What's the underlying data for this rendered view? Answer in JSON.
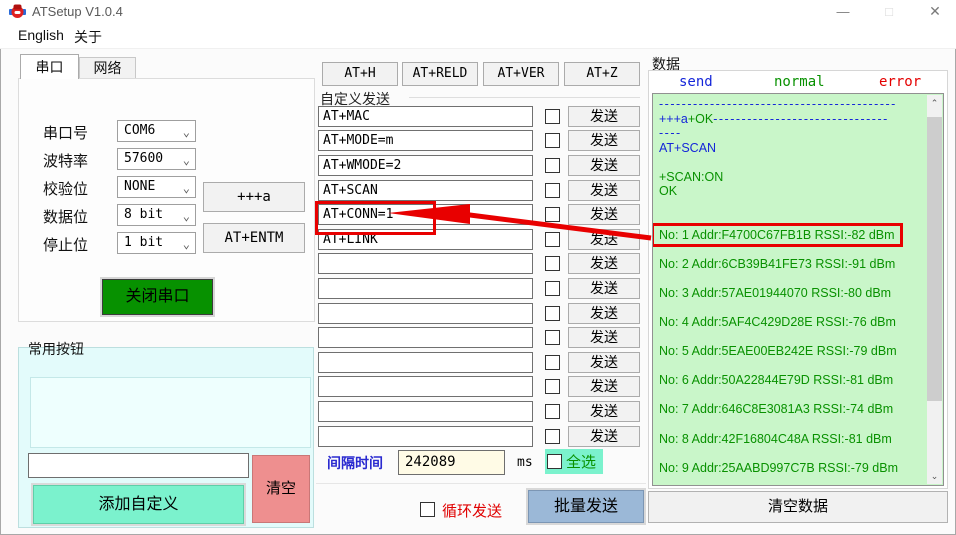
{
  "window": {
    "title": "ATSetup V1.0.4",
    "minimize_glyph": "—",
    "maximize_glyph": "□",
    "close_glyph": "✕"
  },
  "menu": {
    "items": [
      "English",
      "关于"
    ]
  },
  "serial": {
    "tabs": [
      {
        "label": "串口",
        "active": true
      },
      {
        "label": "网络",
        "active": false
      }
    ],
    "fields": [
      {
        "label": "串口号",
        "value": "COM6"
      },
      {
        "label": "波特率",
        "value": "57600"
      },
      {
        "label": "校验位",
        "value": "NONE"
      },
      {
        "label": "数据位",
        "value": "8 bit"
      },
      {
        "label": "停止位",
        "value": "1 bit"
      }
    ],
    "chevron_glyph": "⌄",
    "plus_a_button": "+++a",
    "entm_button": "AT+ENTM",
    "close_port_button": "关闭串口"
  },
  "common": {
    "title": "常用按钮",
    "input_value": "",
    "add_button": "添加自定义",
    "clear_button": "清空"
  },
  "quick_buttons": [
    "AT+H",
    "AT+RELD",
    "AT+VER",
    "AT+Z"
  ],
  "custom_send": {
    "title": "自定义发送",
    "send_label": "发送",
    "rows": [
      {
        "value": "AT+MAC",
        "checked": false,
        "highlight": false
      },
      {
        "value": "AT+MODE=m",
        "checked": false,
        "highlight": false
      },
      {
        "value": "AT+WMODE=2",
        "checked": false,
        "highlight": false
      },
      {
        "value": "AT+SCAN",
        "checked": false,
        "highlight": false
      },
      {
        "value": "AT+CONN=1",
        "checked": false,
        "highlight": true
      },
      {
        "value": "AT+LINK",
        "checked": false,
        "highlight": false
      },
      {
        "value": "",
        "checked": false,
        "highlight": false
      },
      {
        "value": "",
        "checked": false,
        "highlight": false
      },
      {
        "value": "",
        "checked": false,
        "highlight": false
      },
      {
        "value": "",
        "checked": false,
        "highlight": false
      },
      {
        "value": "",
        "checked": false,
        "highlight": false
      },
      {
        "value": "",
        "checked": false,
        "highlight": false
      },
      {
        "value": "",
        "checked": false,
        "highlight": false
      },
      {
        "value": "",
        "checked": false,
        "highlight": false
      }
    ],
    "interval_label": "间隔时间",
    "interval_value": "242089",
    "interval_unit": "ms",
    "select_all_label": "全选",
    "loop_send_label": "循环发送",
    "batch_send_label": "批量发送"
  },
  "data_panel": {
    "title": "数据",
    "colors": {
      "send": "#1526d9",
      "normal": "#089100",
      "error": "#e40000"
    },
    "legend": [
      {
        "label": "send",
        "type": "send"
      },
      {
        "label": "normal",
        "type": "normal"
      },
      {
        "label": "error",
        "type": "error"
      }
    ],
    "log": [
      {
        "segments": [
          {
            "t": "------------------------------------------",
            "c": "send",
            "dash": true
          }
        ]
      },
      {
        "segments": [
          {
            "t": "+++a",
            "c": "send"
          },
          {
            "t": "+OK",
            "c": "normal"
          },
          {
            "t": "-------------------------------",
            "c": "send",
            "dash": true
          }
        ]
      },
      {
        "segments": [
          {
            "t": "----",
            "c": "send",
            "dash": true
          }
        ]
      },
      {
        "segments": [
          {
            "t": "AT+SCAN",
            "c": "send"
          }
        ]
      },
      {
        "segments": []
      },
      {
        "segments": [
          {
            "t": "+SCAN:ON",
            "c": "normal"
          }
        ]
      },
      {
        "segments": [
          {
            "t": "OK",
            "c": "normal"
          }
        ]
      },
      {
        "segments": []
      },
      {
        "segments": []
      },
      {
        "segments": [
          {
            "t": "No: 1 Addr:F4700C67FB1B RSSI:-82 dBm",
            "c": "normal"
          }
        ],
        "boxed": true
      },
      {
        "segments": []
      },
      {
        "segments": [
          {
            "t": "No: 2 Addr:6CB39B41FE73 RSSI:-91 dBm",
            "c": "normal"
          }
        ]
      },
      {
        "segments": []
      },
      {
        "segments": [
          {
            "t": "No: 3 Addr:57AE01944070 RSSI:-80 dBm",
            "c": "normal"
          }
        ]
      },
      {
        "segments": []
      },
      {
        "segments": [
          {
            "t": "No: 4 Addr:5AF4C429D28E RSSI:-76 dBm",
            "c": "normal"
          }
        ]
      },
      {
        "segments": []
      },
      {
        "segments": [
          {
            "t": "No: 5 Addr:5EAE00EB242E RSSI:-79 dBm",
            "c": "normal"
          }
        ]
      },
      {
        "segments": []
      },
      {
        "segments": [
          {
            "t": "No: 6 Addr:50A22844E79D RSSI:-81 dBm",
            "c": "normal"
          }
        ]
      },
      {
        "segments": []
      },
      {
        "segments": [
          {
            "t": "No: 7 Addr:646C8E3081A3 RSSI:-74 dBm",
            "c": "normal"
          }
        ]
      },
      {
        "segments": []
      },
      {
        "segments": [
          {
            "t": "No: 8 Addr:42F16804C48A RSSI:-81 dBm",
            "c": "normal"
          }
        ]
      },
      {
        "segments": []
      },
      {
        "segments": [
          {
            "t": "No: 9 Addr:25AABD997C7B RSSI:-79 dBm",
            "c": "normal"
          }
        ]
      }
    ],
    "clear_button": "清空数据",
    "scrollbar": {
      "up_glyph": "⌃",
      "down_glyph": "⌄"
    }
  }
}
